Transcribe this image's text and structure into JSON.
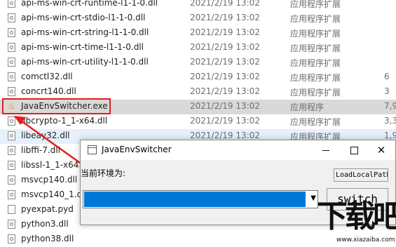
{
  "files": [
    {
      "name": "api-ms-win-crt-runtime-l1-1-0.dll",
      "date": "2021/2/19 13:02",
      "type": "应用程序扩展",
      "size": "",
      "icon": "dll-file-icon"
    },
    {
      "name": "api-ms-win-crt-stdio-l1-1-0.dll",
      "date": "2021/2/19 13:02",
      "type": "应用程序扩展",
      "size": "",
      "icon": "dll-file-icon"
    },
    {
      "name": "api-ms-win-crt-string-l1-1-0.dll",
      "date": "2021/2/19 13:02",
      "type": "应用程序扩展",
      "size": "",
      "icon": "dll-file-icon"
    },
    {
      "name": "api-ms-win-crt-time-l1-1-0.dll",
      "date": "2021/2/19 13:02",
      "type": "应用程序扩展",
      "size": "",
      "icon": "dll-file-icon"
    },
    {
      "name": "api-ms-win-crt-utility-l1-1-0.dll",
      "date": "2021/2/19 13:02",
      "type": "应用程序扩展",
      "size": "",
      "icon": "dll-file-icon"
    },
    {
      "name": "comctl32.dll",
      "date": "2021/2/19 13:02",
      "type": "应用程序扩展",
      "size": "6",
      "icon": "dll-file-icon"
    },
    {
      "name": "concrt140.dll",
      "date": "2021/2/19 13:02",
      "type": "应用程序扩展",
      "size": "3",
      "icon": "dll-file-icon"
    },
    {
      "name": "JavaEnvSwitcher.exe",
      "date": "2021/2/19 13:02",
      "type": "应用程序",
      "size": "7,9",
      "icon": "java-exe-icon",
      "selected": true
    },
    {
      "name": "libcrypto-1_1-x64.dll",
      "date": "2021/2/19 13:02",
      "type": "应用程序扩展",
      "size": "3,3",
      "icon": "dll-file-icon"
    },
    {
      "name": "libeay32.dll",
      "date": "2021/2/19 13:02",
      "type": "应用程序扩展",
      "size": "1,9",
      "icon": "dll-file-icon",
      "hover": true
    },
    {
      "name": "libffi-7.dll",
      "date": "",
      "type": "",
      "size": "",
      "icon": "dll-file-icon"
    },
    {
      "name": "libssl-1_1-x64.dll",
      "date": "",
      "type": "",
      "size": "",
      "icon": "dll-file-icon"
    },
    {
      "name": "msvcp140.dll",
      "date": "",
      "type": "",
      "size": "",
      "icon": "dll-file-icon"
    },
    {
      "name": "msvcp140_1.dll",
      "date": "",
      "type": "",
      "size": "",
      "icon": "dll-file-icon"
    },
    {
      "name": "pyexpat.pyd",
      "date": "",
      "type": "",
      "size": "",
      "icon": "pyd-file-icon"
    },
    {
      "name": "python3.dll",
      "date": "",
      "type": "",
      "size": "",
      "icon": "dll-file-icon"
    },
    {
      "name": "python38.dll",
      "date": "",
      "type": "",
      "size": "",
      "icon": "dll-file-icon"
    }
  ],
  "dialog": {
    "title": "JavaEnvSwitcher",
    "env_label": "当前环境为:",
    "load_button_label": "LoadLocalPath",
    "switch_button_label": "switch",
    "select_arrow": "▼",
    "minimize_icon": "minimize-icon",
    "maximize_icon": "maximize-icon",
    "close_glyph": "✕"
  },
  "watermark": {
    "logo_text": "下载吧",
    "url": "www.xiazaiba.com"
  },
  "colors": {
    "highlight": "#e0201c",
    "selection_blue": "#0078d7",
    "selected_row": "#d9d9d9"
  }
}
